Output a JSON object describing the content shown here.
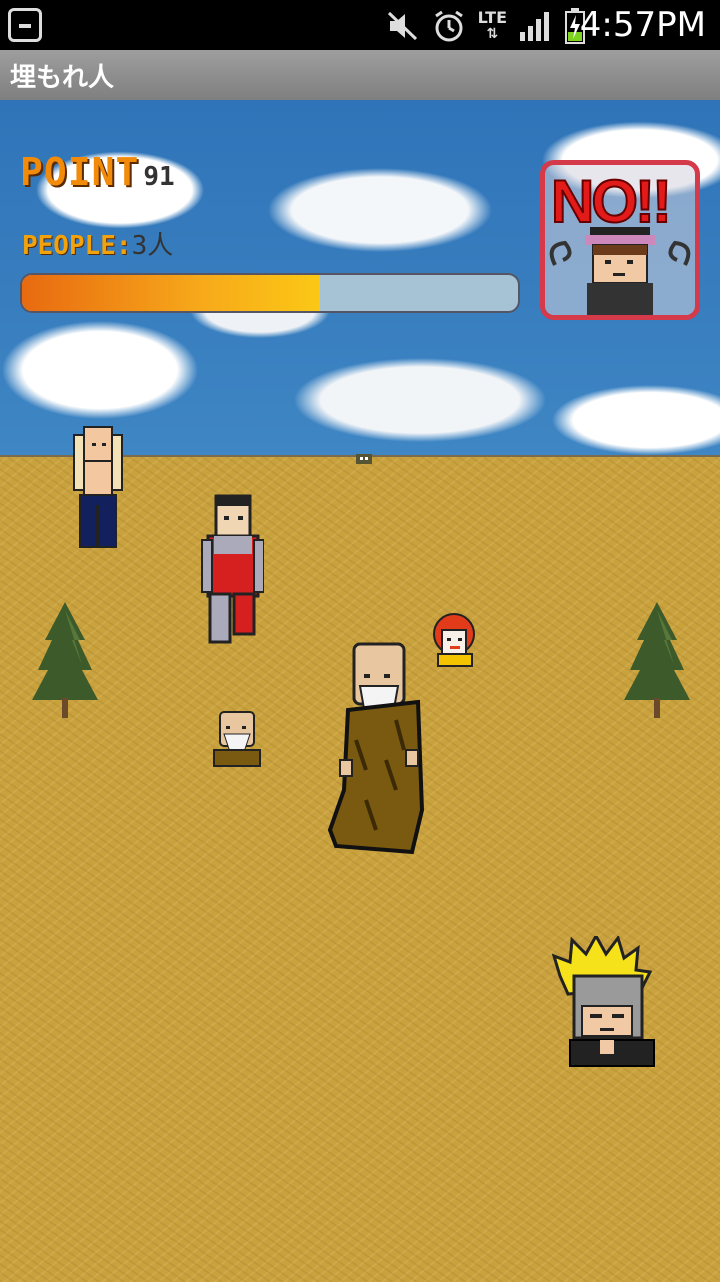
{
  "status_bar": {
    "network": "LTE",
    "time": "4:57PM",
    "icons": [
      "back-icon",
      "mute-icon",
      "alarm-icon",
      "lte-icon",
      "signal-icon",
      "battery-charging-icon"
    ]
  },
  "app": {
    "title": "埋もれ人"
  },
  "hud": {
    "point_label": "POINT",
    "point_value": "91",
    "people_label": "PEOPLE:",
    "people_value": "3人",
    "progress": 0.6
  },
  "no_button": {
    "label": "NO!!"
  },
  "colors": {
    "point_orange": "#f28a0a",
    "progress_start": "#e86a10",
    "progress_end": "#fbc815",
    "no_red": "#e21a1a",
    "ground": "#c9a23e"
  },
  "characters": [
    "bald-long-hair-man-sprite",
    "red-silver-hero-sprite",
    "tiny-distant-person-sprite",
    "clown-head-sprite",
    "old-monk-robe-sprite",
    "buried-old-man-sprite",
    "spiky-hair-gray-face-sprite"
  ],
  "trees": [
    "pine-tree-left",
    "pine-tree-right"
  ]
}
